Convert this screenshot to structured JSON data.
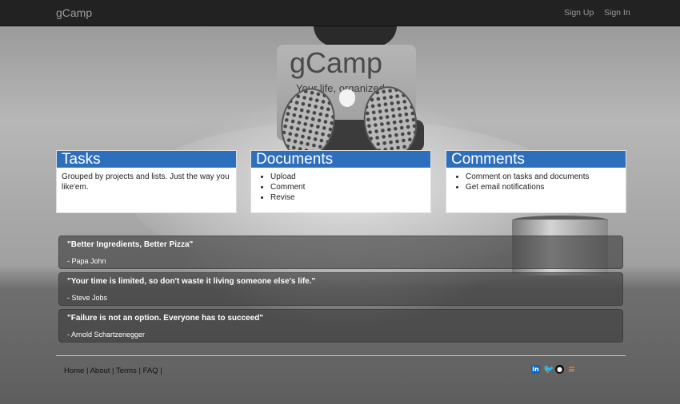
{
  "navbar": {
    "brand": "gCamp",
    "links": {
      "sign_up": "Sign Up",
      "sign_in": "Sign In"
    }
  },
  "hero": {
    "laptop_title": "gCamp",
    "laptop_tagline": "Your life, organized."
  },
  "panels": [
    {
      "title": "Tasks",
      "text": "Grouped by projects and lists. Just the way you like'em."
    },
    {
      "title": "Documents",
      "items": [
        "Upload",
        "Comment",
        "Revise"
      ]
    },
    {
      "title": "Comments",
      "items": [
        "Comment on tasks and documents",
        "Get email notifications"
      ]
    }
  ],
  "quotes": [
    {
      "text": "\"Better Ingredients, Better Pizza\"",
      "author": "- Papa John"
    },
    {
      "text": "\"Your time is limited, so don't waste it living someone else's life.\"",
      "author": "- Steve Jobs"
    },
    {
      "text": "\"Failure is not an option. Everyone has to succeed\"",
      "author": "- Arnold Schartzenegger"
    }
  ],
  "footer": {
    "links": [
      "Home",
      "About",
      "Terms",
      "FAQ"
    ],
    "separator": "|"
  },
  "social_icons": [
    "linkedin-icon",
    "twitter-icon",
    "github-icon",
    "stackoverflow-icon"
  ],
  "colors": {
    "navbar_bg": "#222222",
    "panel_header": "#2e6fbd",
    "quote_bg": "rgba(60,60,60,0.62)"
  }
}
